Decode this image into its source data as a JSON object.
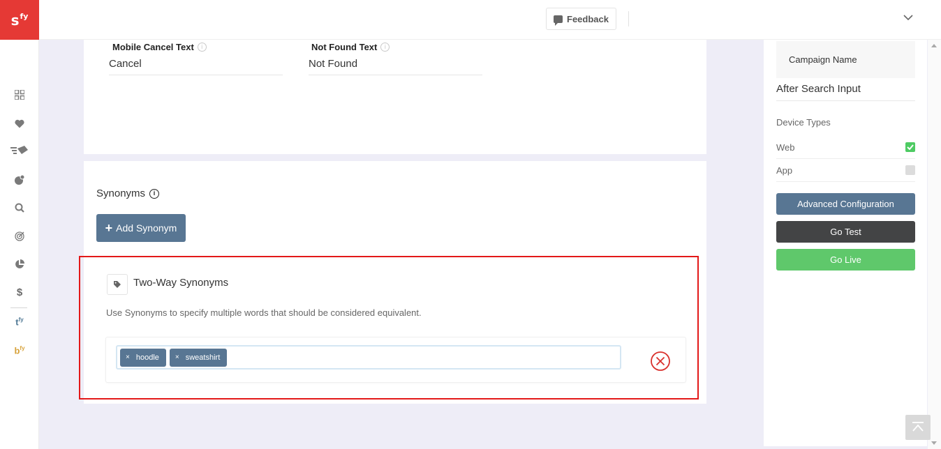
{
  "app": {
    "logo_text": "s",
    "logo_sup": "fy"
  },
  "sidebar": {
    "items": [
      {
        "icon": "grid-icon"
      },
      {
        "icon": "heart-icon"
      },
      {
        "icon": "megaphone-icon"
      },
      {
        "icon": "badge-icon"
      },
      {
        "icon": "search-icon"
      },
      {
        "icon": "target-icon"
      },
      {
        "icon": "pie-chart-icon"
      },
      {
        "icon": "dollar-icon",
        "glyph": "$"
      },
      {
        "icon": "tfy-icon",
        "text": "t",
        "sup": "fy"
      },
      {
        "icon": "bfy-icon",
        "text": "b",
        "sup": "fy"
      }
    ]
  },
  "topbar": {
    "feedback_label": "Feedback"
  },
  "settings": {
    "mobile_cancel_label": "Mobile Cancel Text",
    "mobile_cancel_value": "Cancel",
    "not_found_label": "Not Found Text",
    "not_found_value": "Not Found",
    "info_glyph": "i"
  },
  "synonyms": {
    "title": "Synonyms",
    "add_button": "Add Synonym",
    "group": {
      "title": "Two-Way Synonyms",
      "description": "Use Synonyms to specify multiple words that should be considered equivalent.",
      "tags": [
        "hoodle",
        "sweatshirt"
      ],
      "tag_remove_glyph": "×"
    }
  },
  "right_panel": {
    "campaign_name": "Campaign Name",
    "after_search_input": "After Search Input",
    "device_types_label": "Device Types",
    "devices": [
      {
        "label": "Web",
        "checked": true
      },
      {
        "label": "App",
        "checked": false
      }
    ],
    "advanced_button": "Advanced Configuration",
    "go_test_button": "Go Test",
    "go_live_button": "Go Live"
  },
  "colors": {
    "brand_red": "#e53935",
    "primary": "#587693",
    "dark": "#434445",
    "success": "#5fc86b",
    "highlight": "#e31818"
  }
}
